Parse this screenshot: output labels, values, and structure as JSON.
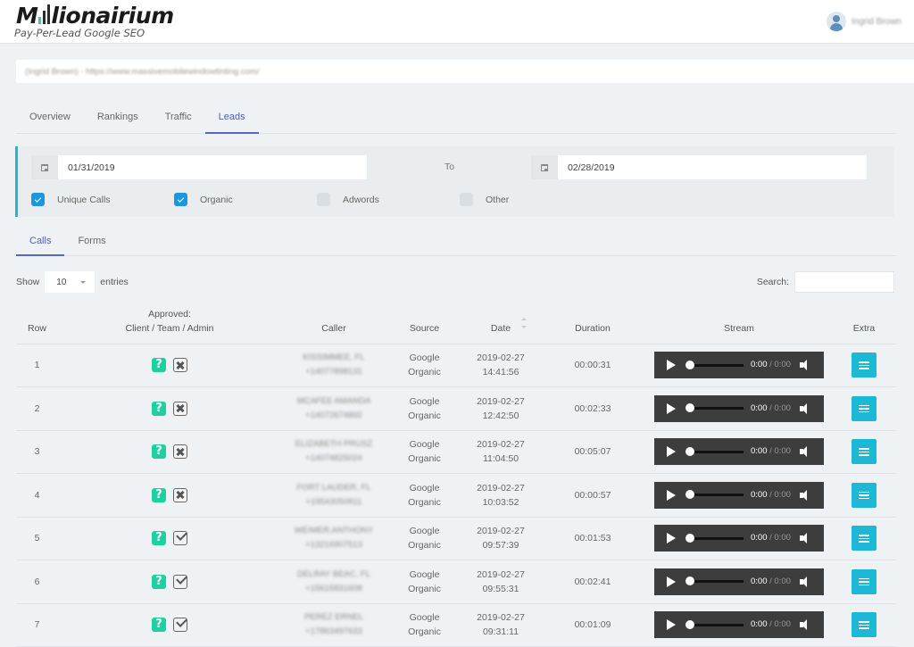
{
  "header": {
    "logo_text_before": "M",
    "logo_text_after": "lionairium",
    "logo_tagline": "Pay-Per-Lead Google SEO",
    "user_name": "Ingrid Brown"
  },
  "site_selector": {
    "value": "(Ingrid Brown) - https://www.massivemobilewindowtinting.com/"
  },
  "main_tabs": [
    {
      "label": "Overview",
      "active": false
    },
    {
      "label": "Rankings",
      "active": false
    },
    {
      "label": "Traffic",
      "active": false
    },
    {
      "label": "Leads",
      "active": true
    }
  ],
  "filters": {
    "from_date": "01/31/2019",
    "to_label": "To",
    "to_date": "02/28/2019",
    "checkboxes": [
      {
        "label": "Unique Calls",
        "checked": true
      },
      {
        "label": "Organic",
        "checked": true
      },
      {
        "label": "Adwords",
        "checked": false
      },
      {
        "label": "Other",
        "checked": false
      }
    ]
  },
  "sub_tabs": [
    {
      "label": "Calls",
      "active": true
    },
    {
      "label": "Forms",
      "active": false
    }
  ],
  "table_controls": {
    "show_label": "Show",
    "entries_value": "10",
    "entries_label": "entries",
    "search_label": "Search:",
    "search_value": ""
  },
  "table": {
    "headers": {
      "row": "Row",
      "approved_line1": "Approved:",
      "approved_line2": "Client / Team / Admin",
      "caller": "Caller",
      "source": "Source",
      "date": "Date",
      "duration": "Duration",
      "stream": "Stream",
      "extra": "Extra"
    },
    "rows": [
      {
        "row": "1",
        "client": "unknown",
        "team": "rejected",
        "caller_name": "KISSIMMEE, FL",
        "caller_phone": "+14077898131",
        "source1": "Google",
        "source2": "Organic",
        "date": "2019-02-27",
        "time": "14:41:56",
        "duration": "00:00:31",
        "current": "0:00",
        "total": "0:00"
      },
      {
        "row": "2",
        "client": "unknown",
        "team": "rejected",
        "caller_name": "MCAFEE AMANDA",
        "caller_phone": "+14072674892",
        "source1": "Google",
        "source2": "Organic",
        "date": "2019-02-27",
        "time": "12:42:50",
        "duration": "00:02:33",
        "current": "0:00",
        "total": "0:00"
      },
      {
        "row": "3",
        "client": "unknown",
        "team": "rejected",
        "caller_name": "ELIZABETH PRUSZ",
        "caller_phone": "+14074825024",
        "source1": "Google",
        "source2": "Organic",
        "date": "2019-02-27",
        "time": "11:04:50",
        "duration": "00:05:07",
        "current": "0:00",
        "total": "0:00"
      },
      {
        "row": "4",
        "client": "unknown",
        "team": "rejected",
        "caller_name": "FORT LAUDER, FL",
        "caller_phone": "+19543050811",
        "source1": "Google",
        "source2": "Organic",
        "date": "2019-02-27",
        "time": "10:03:52",
        "duration": "00:00:57",
        "current": "0:00",
        "total": "0:00"
      },
      {
        "row": "5",
        "client": "unknown",
        "team": "approved",
        "caller_name": "WEIMER,ANTHONY",
        "caller_phone": "+13216907513",
        "source1": "Google",
        "source2": "Organic",
        "date": "2019-02-27",
        "time": "09:57:39",
        "duration": "00:01:53",
        "current": "0:00",
        "total": "0:00"
      },
      {
        "row": "6",
        "client": "unknown",
        "team": "approved",
        "caller_name": "DELRAY BEAC, FL",
        "caller_phone": "+15615831608",
        "source1": "Google",
        "source2": "Organic",
        "date": "2019-02-27",
        "time": "09:55:31",
        "duration": "00:02:41",
        "current": "0:00",
        "total": "0:00"
      },
      {
        "row": "7",
        "client": "unknown",
        "team": "approved",
        "caller_name": "PEREZ ERNEL",
        "caller_phone": "+17863497633",
        "source1": "Google",
        "source2": "Organic",
        "date": "2019-02-27",
        "time": "09:31:11",
        "duration": "00:01:09",
        "current": "0:00",
        "total": "0:00"
      }
    ]
  },
  "colors": {
    "accent_tab": "#5566c4",
    "panel_border": "#20b6d4",
    "checkbox_on": "#1a97e0",
    "approval_unknown": "#1dd0a0",
    "extra_button": "#1cb8d6",
    "player_bg": "#3d3d3d"
  }
}
